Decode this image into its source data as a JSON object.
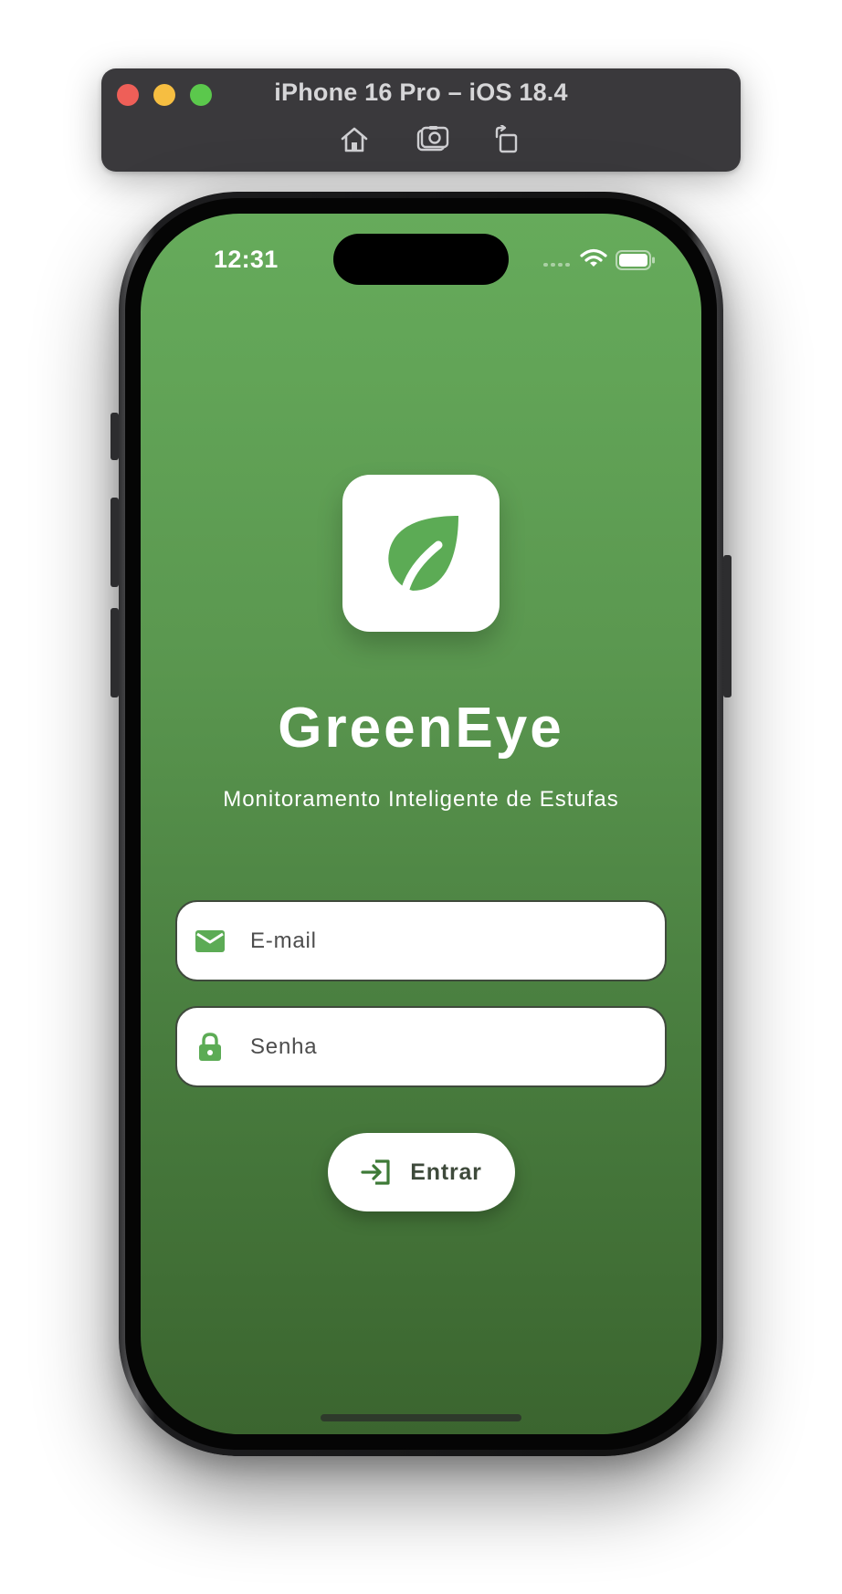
{
  "simulator": {
    "title": "iPhone 16 Pro – iOS 18.4",
    "tools": [
      "home-icon",
      "screenshot-icon",
      "rotate-icon"
    ]
  },
  "status_bar": {
    "time": "12:31"
  },
  "app": {
    "name": "GreenEye",
    "tagline": "Monitoramento Inteligente de Estufas",
    "logo_icon": "leaf-icon"
  },
  "form": {
    "email": {
      "placeholder": "E-mail",
      "value": "",
      "icon": "mail-icon"
    },
    "password": {
      "placeholder": "Senha",
      "value": "",
      "icon": "lock-icon"
    },
    "submit": {
      "label": "Entrar",
      "icon": "login-icon"
    }
  },
  "colors": {
    "brand_green": "#5cab55",
    "background_top": "#66ab5b",
    "background_bottom": "#3b652f",
    "button_text": "#3e4a3b"
  }
}
